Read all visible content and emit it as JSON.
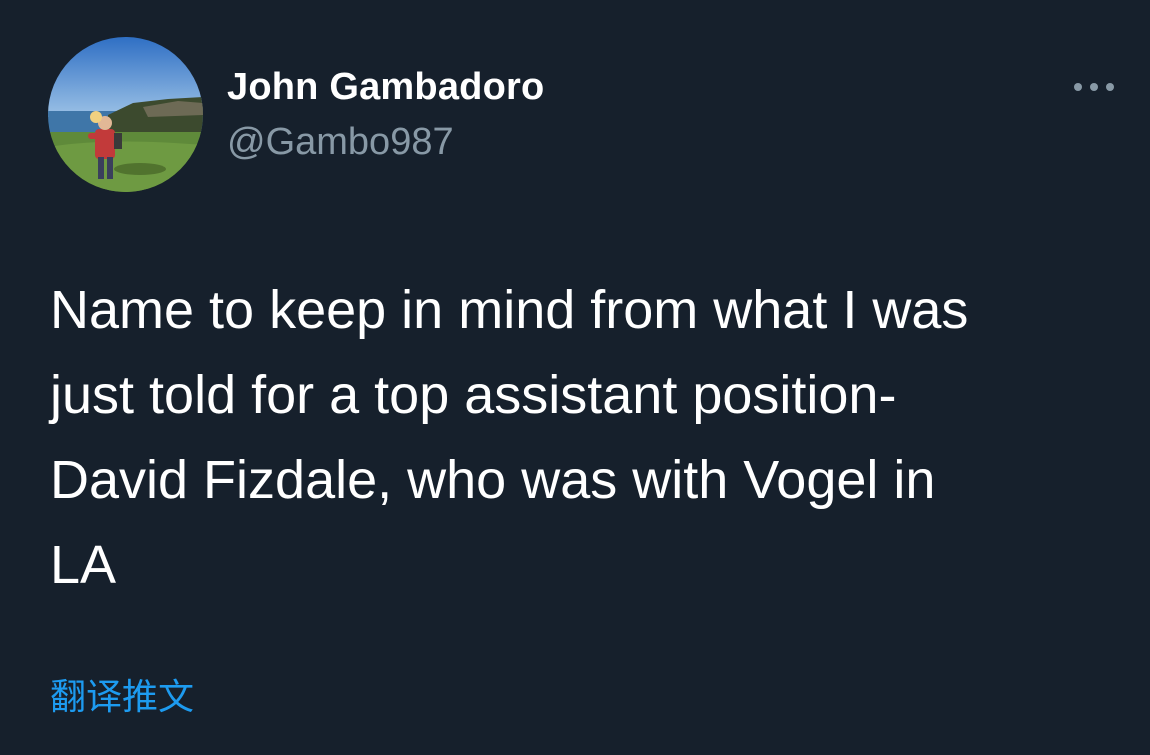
{
  "author": {
    "display_name": "John Gambadoro",
    "handle": "@Gambo987",
    "avatar_icon": "profile-photo"
  },
  "more_icon": "more-options-icon",
  "tweet": {
    "lines": [
      "Name to keep in mind from what I was",
      "just told for a top assistant position-",
      "David Fizdale, who was with Vogel in",
      "LA"
    ]
  },
  "translate_label": "翻译推文",
  "colors": {
    "background": "#16202c",
    "text": "#ffffff",
    "secondary_text": "#8899a6",
    "link": "#1d9bf0"
  }
}
